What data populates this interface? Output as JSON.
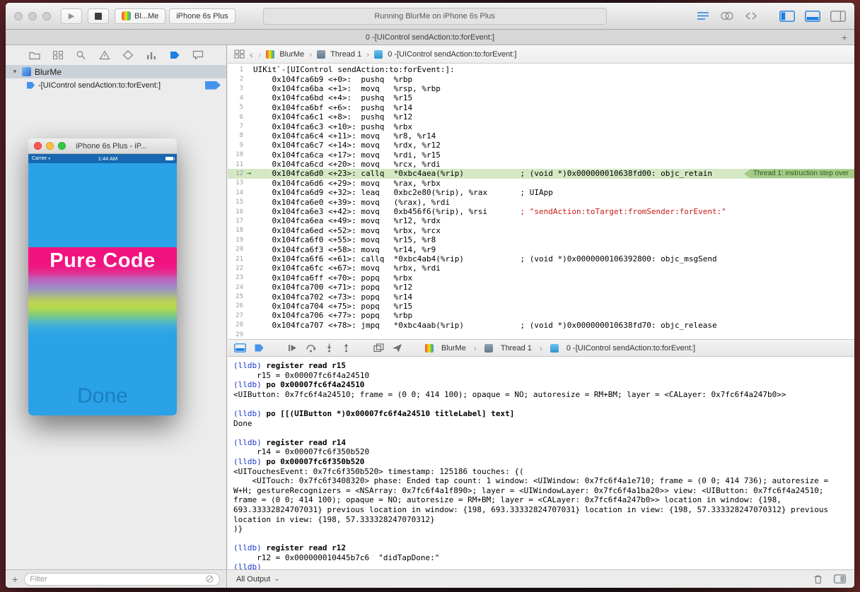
{
  "icons": {
    "play": "▶",
    "back": "‹",
    "forward": "›",
    "chevron": "›",
    "disclosure": "▾",
    "footer_chevron": "⌄",
    "add": "+",
    "carrier_chevron": "▾"
  },
  "toolbar": {
    "scheme_app": "Bl...Me",
    "scheme_device": "iPhone 6s Plus",
    "status": "Running BlurMe on iPhone 6s Plus",
    "right_icons": [
      "standard-editor-icon",
      "assistant-editor-icon",
      "version-editor-icon",
      "navigator-toggle-icon",
      "debug-area-toggle-icon",
      "utilities-toggle-icon"
    ]
  },
  "tabbar": {
    "title": "0 -[UIControl sendAction:to:forEvent:]"
  },
  "navigator": {
    "icons": [
      "project-navigator-icon",
      "symbol-navigator-icon",
      "search-navigator-icon",
      "issue-navigator-icon",
      "test-navigator-icon",
      "debug-navigator-icon",
      "breakpoint-navigator-icon",
      "report-navigator-icon"
    ],
    "project": "BlurMe",
    "breakpoint": "-[UIControl sendAction:to:forEvent:]",
    "filter_placeholder": "Filter"
  },
  "simulator": {
    "title": "iPhone 6s Plus - iP...",
    "carrier": "Carrier",
    "time": "1:44 AM",
    "banner": "Pure Code",
    "button": "Done"
  },
  "editor": {
    "breadcrumb": [
      "BlurMe",
      "Thread 1",
      "0 -[UIControl sendAction:to:forEvent:]"
    ],
    "comment_column": 57,
    "lines": [
      {
        "n": 1,
        "code": "UIKit`-[UIControl sendAction:to:forEvent:]:"
      },
      {
        "n": 2,
        "code": "    0x104fca6b9 <+0>:  pushq  %rbp"
      },
      {
        "n": 3,
        "code": "    0x104fca6ba <+1>:  movq   %rsp, %rbp"
      },
      {
        "n": 4,
        "code": "    0x104fca6bd <+4>:  pushq  %r15"
      },
      {
        "n": 5,
        "code": "    0x104fca6bf <+6>:  pushq  %r14"
      },
      {
        "n": 6,
        "code": "    0x104fca6c1 <+8>:  pushq  %r12"
      },
      {
        "n": 7,
        "code": "    0x104fca6c3 <+10>: pushq  %rbx"
      },
      {
        "n": 8,
        "code": "    0x104fca6c4 <+11>: movq   %r8, %r14"
      },
      {
        "n": 9,
        "code": "    0x104fca6c7 <+14>: movq   %rdx, %r12"
      },
      {
        "n": 10,
        "code": "    0x104fca6ca <+17>: movq   %rdi, %r15"
      },
      {
        "n": 11,
        "code": "    0x104fca6cd <+20>: movq   %rcx, %rdi"
      },
      {
        "n": 12,
        "code": "    0x104fca6d0 <+23>: callq  *0xbc4aea(%rip)",
        "comment": "; (void *)0x000000010638fd00: objc_retain",
        "current": true,
        "badge": "Thread 1: instruction step over"
      },
      {
        "n": 13,
        "code": "    0x104fca6d6 <+29>: movq   %rax, %rbx"
      },
      {
        "n": 14,
        "code": "    0x104fca6d9 <+32>: leaq   0xbc2e80(%rip), %rax",
        "comment": "; UIApp"
      },
      {
        "n": 15,
        "code": "    0x104fca6e0 <+39>: movq   (%rax), %rdi"
      },
      {
        "n": 16,
        "code": "    0x104fca6e3 <+42>: movq   0xb456f6(%rip), %rsi",
        "comment": "; \"sendAction:toTarget:fromSender:forEvent:\"",
        "red": true
      },
      {
        "n": 17,
        "code": "    0x104fca6ea <+49>: movq   %r12, %rdx"
      },
      {
        "n": 18,
        "code": "    0x104fca6ed <+52>: movq   %rbx, %rcx"
      },
      {
        "n": 19,
        "code": "    0x104fca6f0 <+55>: movq   %r15, %r8"
      },
      {
        "n": 20,
        "code": "    0x104fca6f3 <+58>: movq   %r14, %r9"
      },
      {
        "n": 21,
        "code": "    0x104fca6f6 <+61>: callq  *0xbc4ab4(%rip)",
        "comment": "; (void *)0x0000000106392800: objc_msgSend"
      },
      {
        "n": 22,
        "code": "    0x104fca6fc <+67>: movq   %rbx, %rdi"
      },
      {
        "n": 23,
        "code": "    0x104fca6ff <+70>: popq   %rbx"
      },
      {
        "n": 24,
        "code": "    0x104fca700 <+71>: popq   %r12"
      },
      {
        "n": 25,
        "code": "    0x104fca702 <+73>: popq   %r14"
      },
      {
        "n": 26,
        "code": "    0x104fca704 <+75>: popq   %r15"
      },
      {
        "n": 27,
        "code": "    0x104fca706 <+77>: popq   %rbp"
      },
      {
        "n": 28,
        "code": "    0x104fca707 <+78>: jmpq   *0xbc4aab(%rip)",
        "comment": "; (void *)0x000000010638fd70: objc_release"
      },
      {
        "n": 29,
        "code": ""
      }
    ]
  },
  "debugbar": {
    "icons": [
      "hide-debug-area-icon",
      "breakpoints-toggle-icon",
      "continue-icon",
      "step-over-icon",
      "step-into-icon",
      "step-out-icon",
      "debug-view-hierarchy-icon",
      "simulate-location-icon"
    ],
    "crumbs": [
      "BlurMe",
      "Thread 1",
      "0 -[UIControl sendAction:to:forEvent:]"
    ]
  },
  "console": {
    "prompt": "(lldb)",
    "footer": "All Output",
    "lines": [
      {
        "prompt": true,
        "cmd": "register read r15"
      },
      {
        "text": "     r15 = 0x00007fc6f4a24510"
      },
      {
        "prompt": true,
        "cmd": "po 0x00007fc6f4a24510"
      },
      {
        "text": "<UIButton: 0x7fc6f4a24510; frame = (0 0; 414 100); opaque = NO; autoresize = RM+BM; layer = <CALayer: 0x7fc6f4a247b0>>"
      },
      {
        "text": ""
      },
      {
        "prompt": true,
        "cmd": "po [[(UIButton *)0x00007fc6f4a24510 titleLabel] text]"
      },
      {
        "text": "Done"
      },
      {
        "text": ""
      },
      {
        "prompt": true,
        "cmd": "register read r14"
      },
      {
        "text": "     r14 = 0x00007fc6f350b520"
      },
      {
        "prompt": true,
        "cmd": "po 0x00007fc6f350b520"
      },
      {
        "text": "<UITouchesEvent: 0x7fc6f350b520> timestamp: 125186 touches: {("
      },
      {
        "text": "    <UITouch: 0x7fc6f3408320> phase: Ended tap count: 1 window: <UIWindow: 0x7fc6f4a1e710; frame = (0 0; 414 736); autoresize = W+H; gestureRecognizers = <NSArray: 0x7fc6f4a1f890>; layer = <UIWindowLayer: 0x7fc6f4a1ba20>> view: <UIButton: 0x7fc6f4a24510; frame = (0 0; 414 100); opaque = NO; autoresize = RM+BM; layer = <CALayer: 0x7fc6f4a247b0>> location in window: {198, 693.33332824707031} previous location in window: {198, 693.33332824707031} location in view: {198, 57.333328247070312} previous location in view: {198, 57.333328247070312}"
      },
      {
        "text": ")}"
      },
      {
        "text": ""
      },
      {
        "prompt": true,
        "cmd": "register read r12"
      },
      {
        "text": "     r12 = 0x000000010445b7c6  \"didTapDone:\""
      },
      {
        "prompt": true,
        "cmd": ""
      }
    ]
  },
  "colors": {
    "accent_blue": "#1d7fe0",
    "breakpoint_blue": "#4493ec",
    "current_line_green": "#d4e8c4",
    "badge_green": "#a4cc88",
    "string_red": "#c41a16",
    "lldb_prompt_blue": "#2038cf",
    "banner_pink": "#f1127f",
    "screen_blue": "#2ba2e8"
  }
}
